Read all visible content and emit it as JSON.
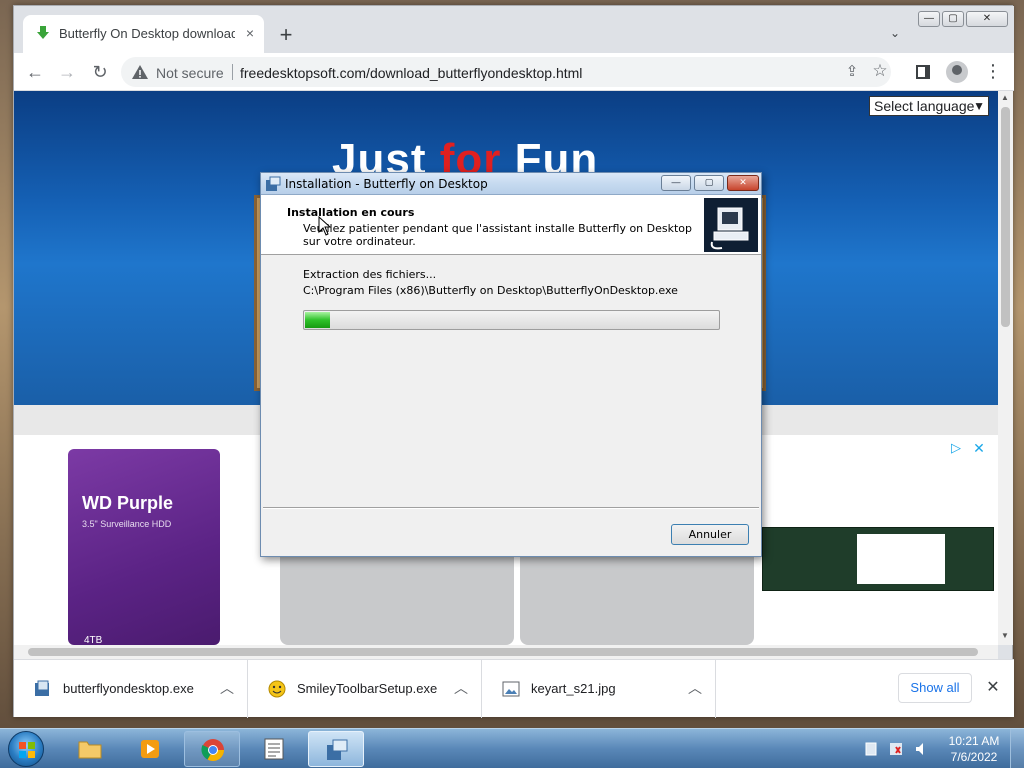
{
  "browser": {
    "tab": {
      "title": "Butterfly On Desktop download |",
      "close": "×"
    },
    "new_tab": "+",
    "tab_search": "⌄",
    "window_buttons": {
      "minimize": "—",
      "maximize": "▢",
      "close": "✕"
    },
    "nav": {
      "back": "←",
      "forward": "→",
      "reload": "↻"
    },
    "address": {
      "security": "Not secure",
      "url": "freedesktopsoft.com/download_butterflyondesktop.html"
    },
    "menu": "⋮",
    "share": "⇪",
    "star": "☆"
  },
  "page": {
    "hero_title_part1": "Just ",
    "hero_title_part2": "for",
    "hero_title_part3": " Fun",
    "language_select": "Select language",
    "ad": {
      "hdd_brand": "WD Purple",
      "hdd_sub": "3.5\" Surveillance HDD",
      "hdd_capacity": "4TB",
      "close": "✕"
    }
  },
  "downloads": [
    {
      "name": "butterflyondesktop.exe",
      "icon": "installer-icon"
    },
    {
      "name": "SmileyToolbarSetup.exe",
      "icon": "smiley-icon"
    },
    {
      "name": "keyart_s21.jpg",
      "icon": "image-file-icon"
    }
  ],
  "shelf": {
    "show_all": "Show all",
    "close": "✕"
  },
  "dialog": {
    "title": "Installation - Butterfly on Desktop",
    "heading": "Installation en cours",
    "subheading": "Veuillez patienter pendant que l'assistant installe Butterfly on Desktop sur votre ordinateur.",
    "status": "Extraction des fichiers...",
    "file": "C:\\Program Files (x86)\\Butterfly on Desktop\\ButterflyOnDesktop.exe",
    "progress_fraction": 0.06,
    "cancel": "Annuler",
    "buttons": {
      "minimize": "—",
      "maximize": "▢",
      "close": "✕"
    }
  },
  "taskbar": {
    "time": "10:21 AM",
    "date": "7/6/2022"
  }
}
